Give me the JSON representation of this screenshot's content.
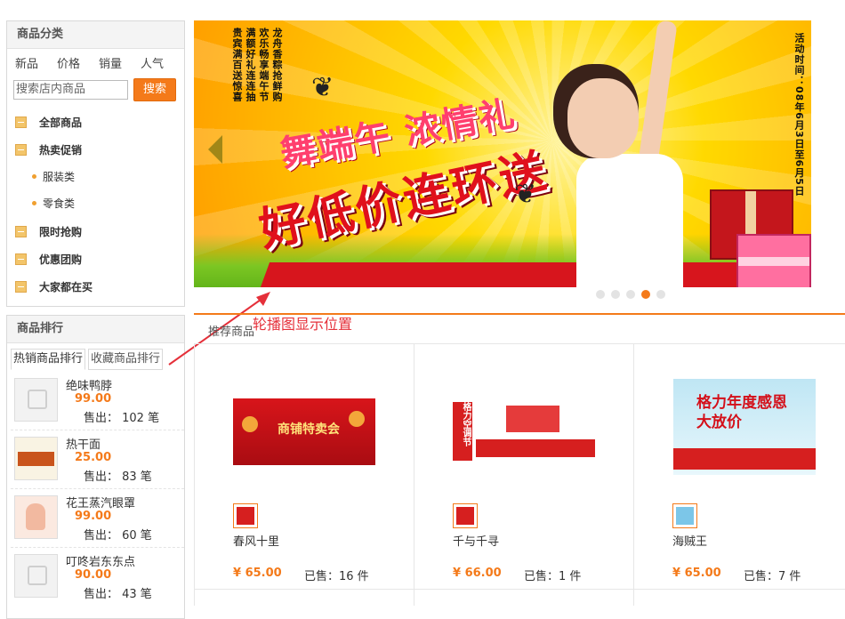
{
  "sidebar": {
    "categories_title": "商品分类",
    "sort_tabs": [
      "新品",
      "价格",
      "销量",
      "人气"
    ],
    "search": {
      "placeholder": "搜索店内商品",
      "button": "搜索"
    },
    "tree": [
      {
        "label": "全部商品"
      },
      {
        "label": "热卖促销"
      },
      {
        "label": "服装类",
        "sub": true
      },
      {
        "label": "零食类",
        "sub": true
      },
      {
        "label": "限时抢购"
      },
      {
        "label": "优惠团购"
      },
      {
        "label": "大家都在买"
      }
    ],
    "ranking_title": "商品排行",
    "ranking_tabs": [
      "热销商品排行",
      "收藏商品排行"
    ],
    "ranking_items": [
      {
        "name": "绝味鸭脖",
        "price": "99.00",
        "sold": "售出： 102 笔"
      },
      {
        "name": "热干面",
        "price": "25.00",
        "sold": "售出： 83 笔"
      },
      {
        "name": "花王蒸汽眼罩",
        "price": "99.00",
        "sold": "售出： 60 笔"
      },
      {
        "name": "叮咚岩东东点",
        "price": "90.00",
        "sold": "售出： 43 笔"
      }
    ]
  },
  "banner": {
    "vertical_text": [
      "龙舟香粽抢鲜购",
      "欢乐畅享端午节",
      "满额好礼连连抽",
      "贵宾满百送惊喜"
    ],
    "activity": "活动时间：08年6月3日至6月5日",
    "slogan_top": "舞端午 浓情礼",
    "slogan_main": "好低价连环送",
    "dot_count": 5,
    "active_dot": 4
  },
  "annotation": "轮播图显示位置",
  "recommend": {
    "title": "推荐商品",
    "products": [
      {
        "name": "春风十里",
        "price": "¥ 65.00",
        "sold": "已售：16 件",
        "img_text": "商铺特卖会"
      },
      {
        "name": "千与千寻",
        "price": "¥ 66.00",
        "sold": "已售：1 件",
        "img_text": "格力空调节"
      },
      {
        "name": "海贼王",
        "price": "¥ 65.00",
        "sold": "已售：7 件",
        "img_text": "格力年度感恩大放价"
      }
    ]
  },
  "colors": {
    "accent": "#f47a1a",
    "annotation": "#e5303a"
  }
}
